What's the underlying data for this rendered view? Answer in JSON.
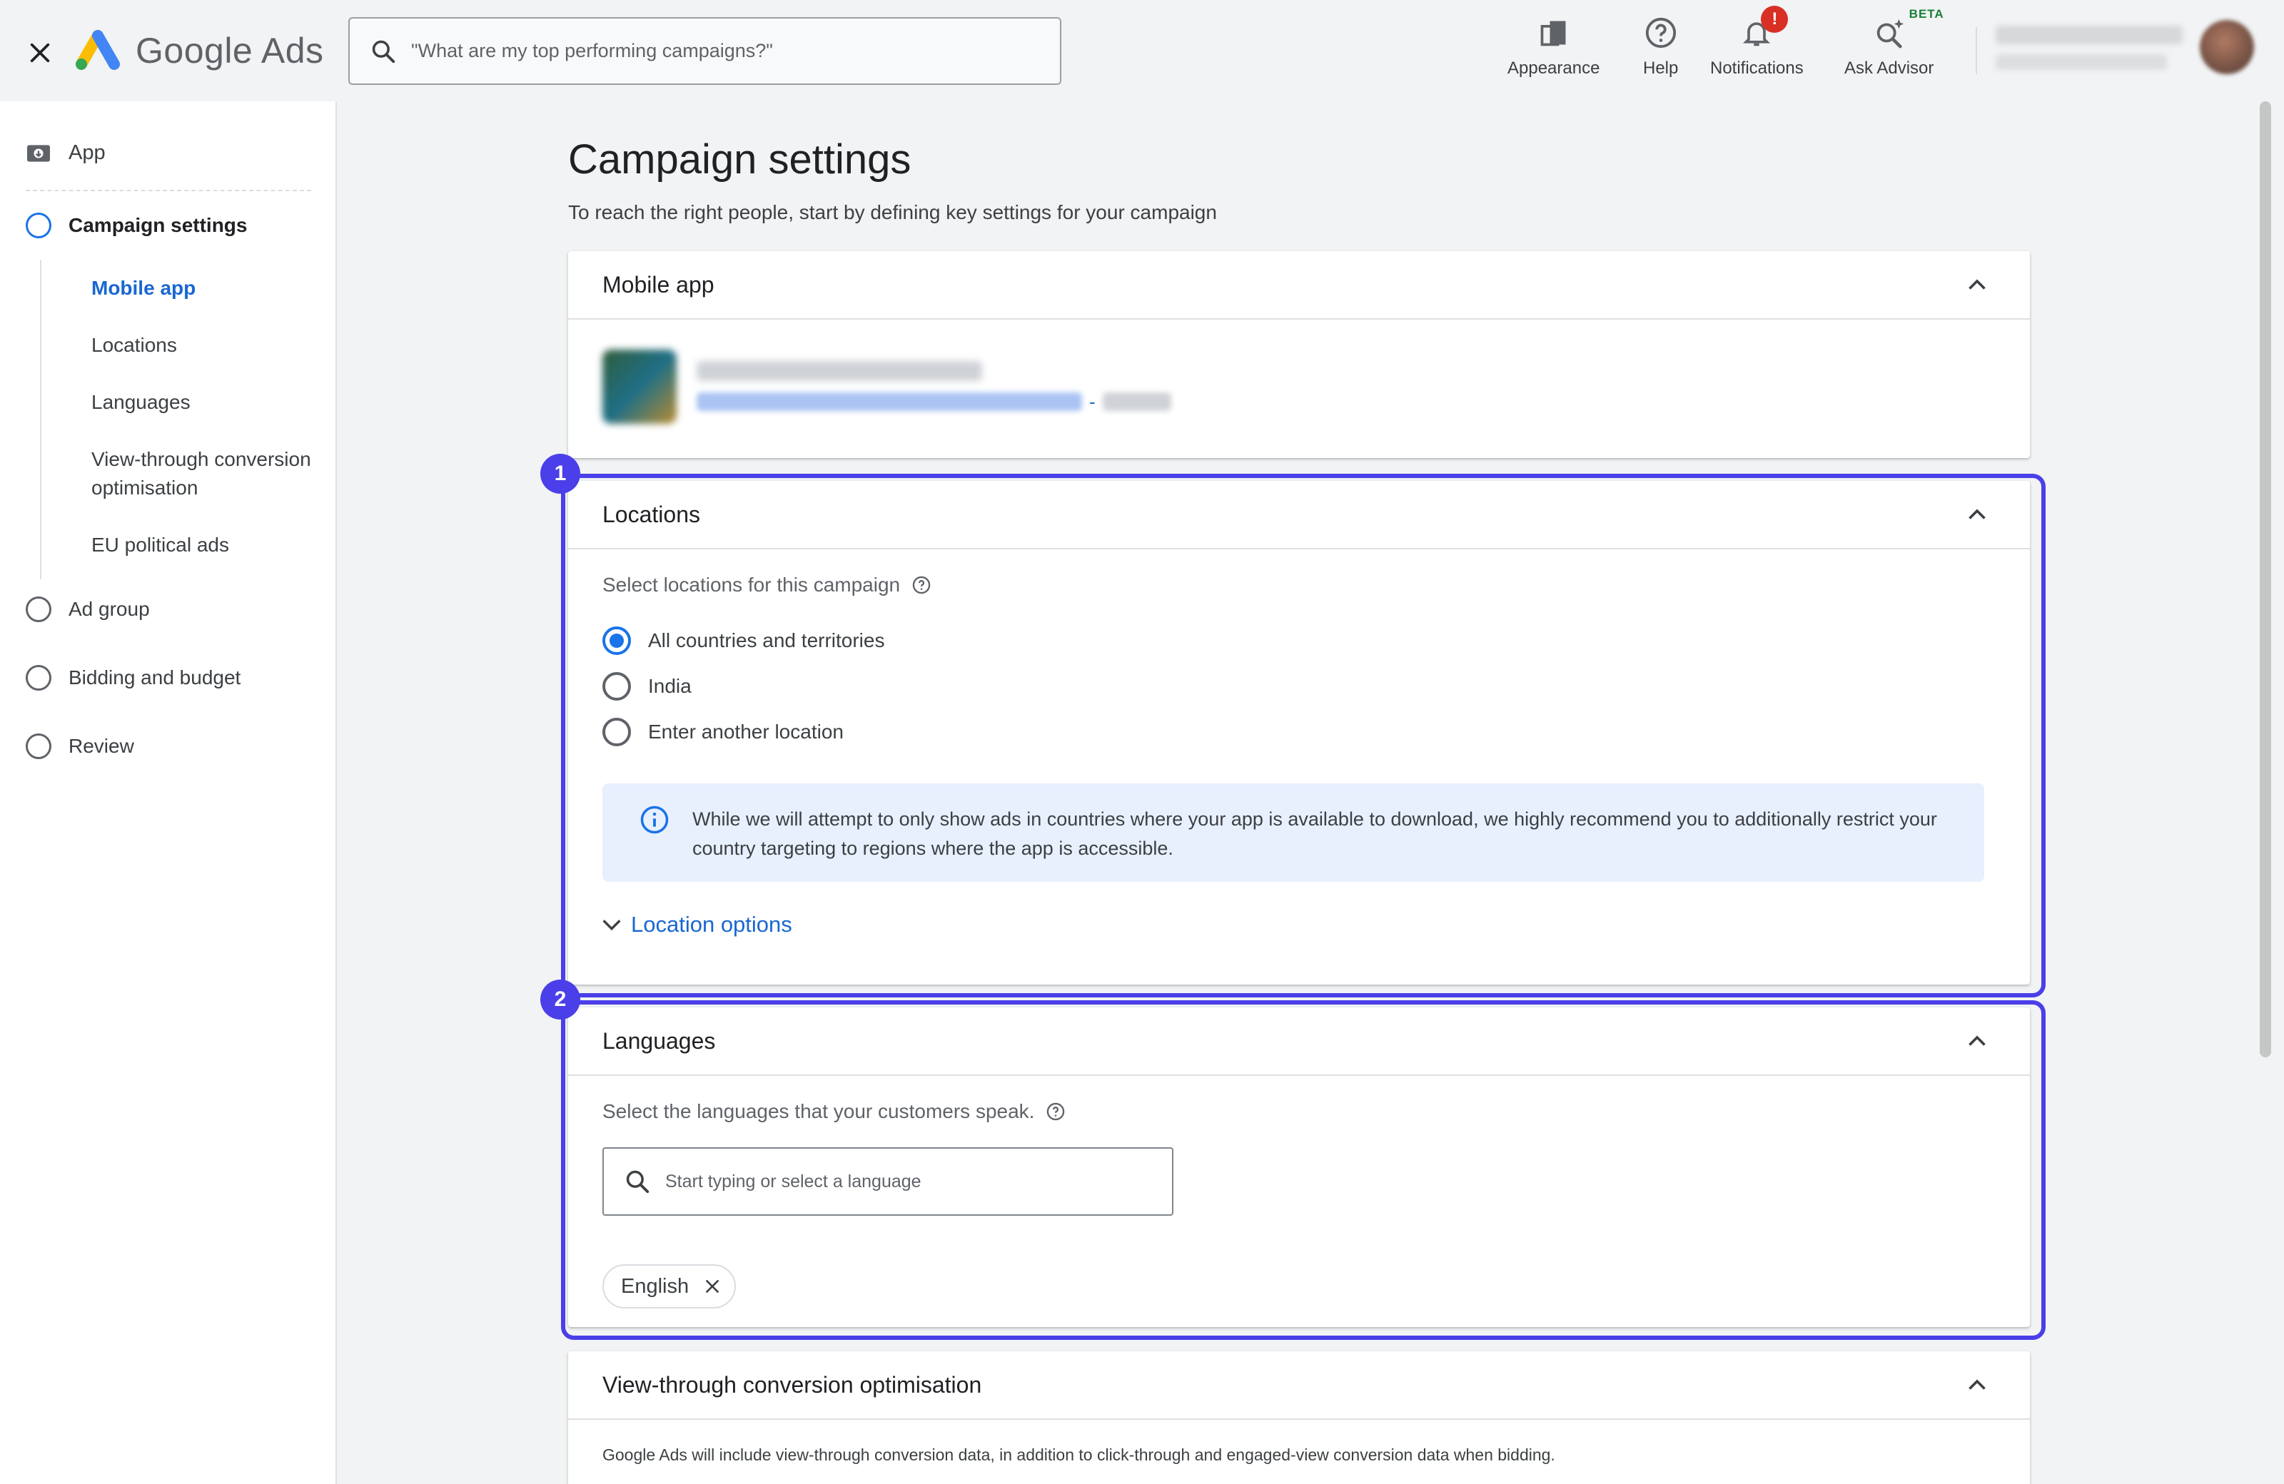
{
  "topbar": {
    "product_name": "Google Ads",
    "search_placeholder": "\"What are my top performing campaigns?\"",
    "tools": [
      {
        "label": "Appearance",
        "icon": "appearance-icon"
      },
      {
        "label": "Help",
        "icon": "help-icon"
      },
      {
        "label": "Notifications",
        "icon": "bell-icon",
        "badge": "!"
      },
      {
        "label": "Ask Advisor",
        "icon": "advisor-icon",
        "tag": "BETA"
      }
    ],
    "colors": {
      "badge": "#d93025",
      "beta": "#188038"
    }
  },
  "sidebar": {
    "app_label": "App",
    "steps": [
      {
        "label": "Campaign settings",
        "active": true
      },
      {
        "label": "Ad group"
      },
      {
        "label": "Bidding and budget"
      },
      {
        "label": "Review"
      }
    ],
    "sub_items": [
      "Mobile app",
      "Locations",
      "Languages",
      "View-through conversion optimisation",
      "EU political ads"
    ]
  },
  "main": {
    "title": "Campaign settings",
    "subtitle": "To reach the right people, start by defining key settings for your campaign",
    "mobile_app": {
      "title": "Mobile app",
      "link_separator": "-"
    },
    "locations": {
      "badge": "1",
      "title": "Locations",
      "prompt": "Select locations for this campaign",
      "options": [
        "All countries and territories",
        "India",
        "Enter another location"
      ],
      "selected": "All countries and territories",
      "info": "While we will attempt to only show ads in countries where your app is available to download, we highly recommend you to additionally restrict your country targeting to regions where the app is accessible.",
      "more_options": "Location options"
    },
    "languages": {
      "badge": "2",
      "title": "Languages",
      "prompt": "Select the languages that your customers speak.",
      "search_placeholder": "Start typing or select a language",
      "chips": [
        "English"
      ]
    },
    "view_through": {
      "title": "View-through conversion optimisation",
      "description": "Google Ads will include view-through conversion data, in addition to click-through and engaged-view conversion data when bidding."
    }
  },
  "colors": {
    "accent": "#1a73e8",
    "link": "#1967d2",
    "highlight": "#4a3fe8",
    "info_bg": "#e8f0fe"
  }
}
